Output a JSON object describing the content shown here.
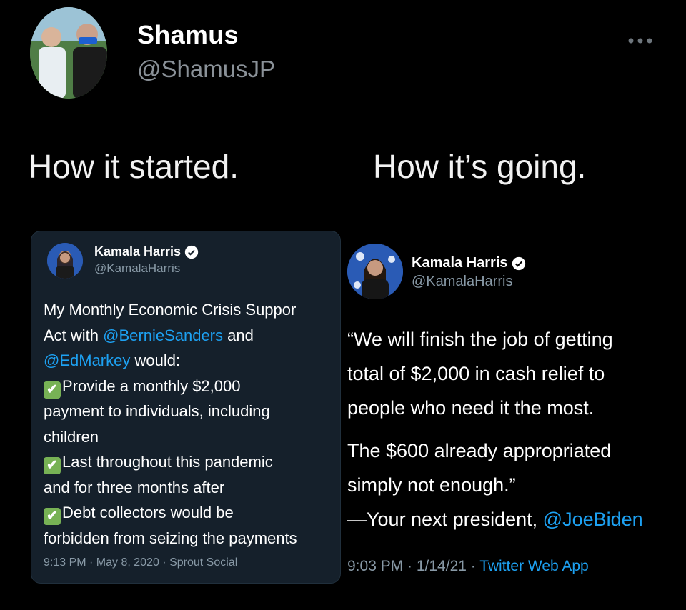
{
  "author": {
    "name": "Shamus",
    "handle": "@ShamusJP"
  },
  "more_icon": "more-horizontal-icon",
  "captions": {
    "left": "How it started.",
    "right": "How it’s going."
  },
  "left_tweet": {
    "name": "Kamala Harris",
    "handle": "@KamalaHarris",
    "lines": {
      "l1": "My Monthly Economic Crisis Suppor",
      "l2a": "Act with ",
      "l2link": "@BernieSanders",
      "l2b": " and",
      "l3link": "@EdMarkey",
      "l3b": " would:",
      "l4": "Provide a monthly $2,000",
      "l5": "payment to individuals, including",
      "l6": "children",
      "l7": "Last throughout this pandemic",
      "l8": "and for three months after",
      "l9": "Debt collectors would be",
      "l10": "forbidden from seizing the payments"
    },
    "check_glyph": "✔",
    "meta": "9:13 PM · May 8, 2020 · Sprout Social"
  },
  "right_tweet": {
    "name": "Kamala Harris",
    "handle": "@KamalaHarris",
    "lines": {
      "l1": "“We will finish the job of getting",
      "l2": "total of $2,000 in cash relief to",
      "l3": "people who need it the most.",
      "l4": "The $600 already appropriated",
      "l5": "simply not enough.”",
      "l6a": "—Your next president, ",
      "l6link": "@JoeBiden"
    },
    "meta_plain": "9:03 PM · 1/14/21 · ",
    "meta_link": "Twitter Web App"
  },
  "colors": {
    "link": "#1da1f2",
    "verified": "#1da1f2",
    "check": "#77b255",
    "card": "#15202b"
  }
}
